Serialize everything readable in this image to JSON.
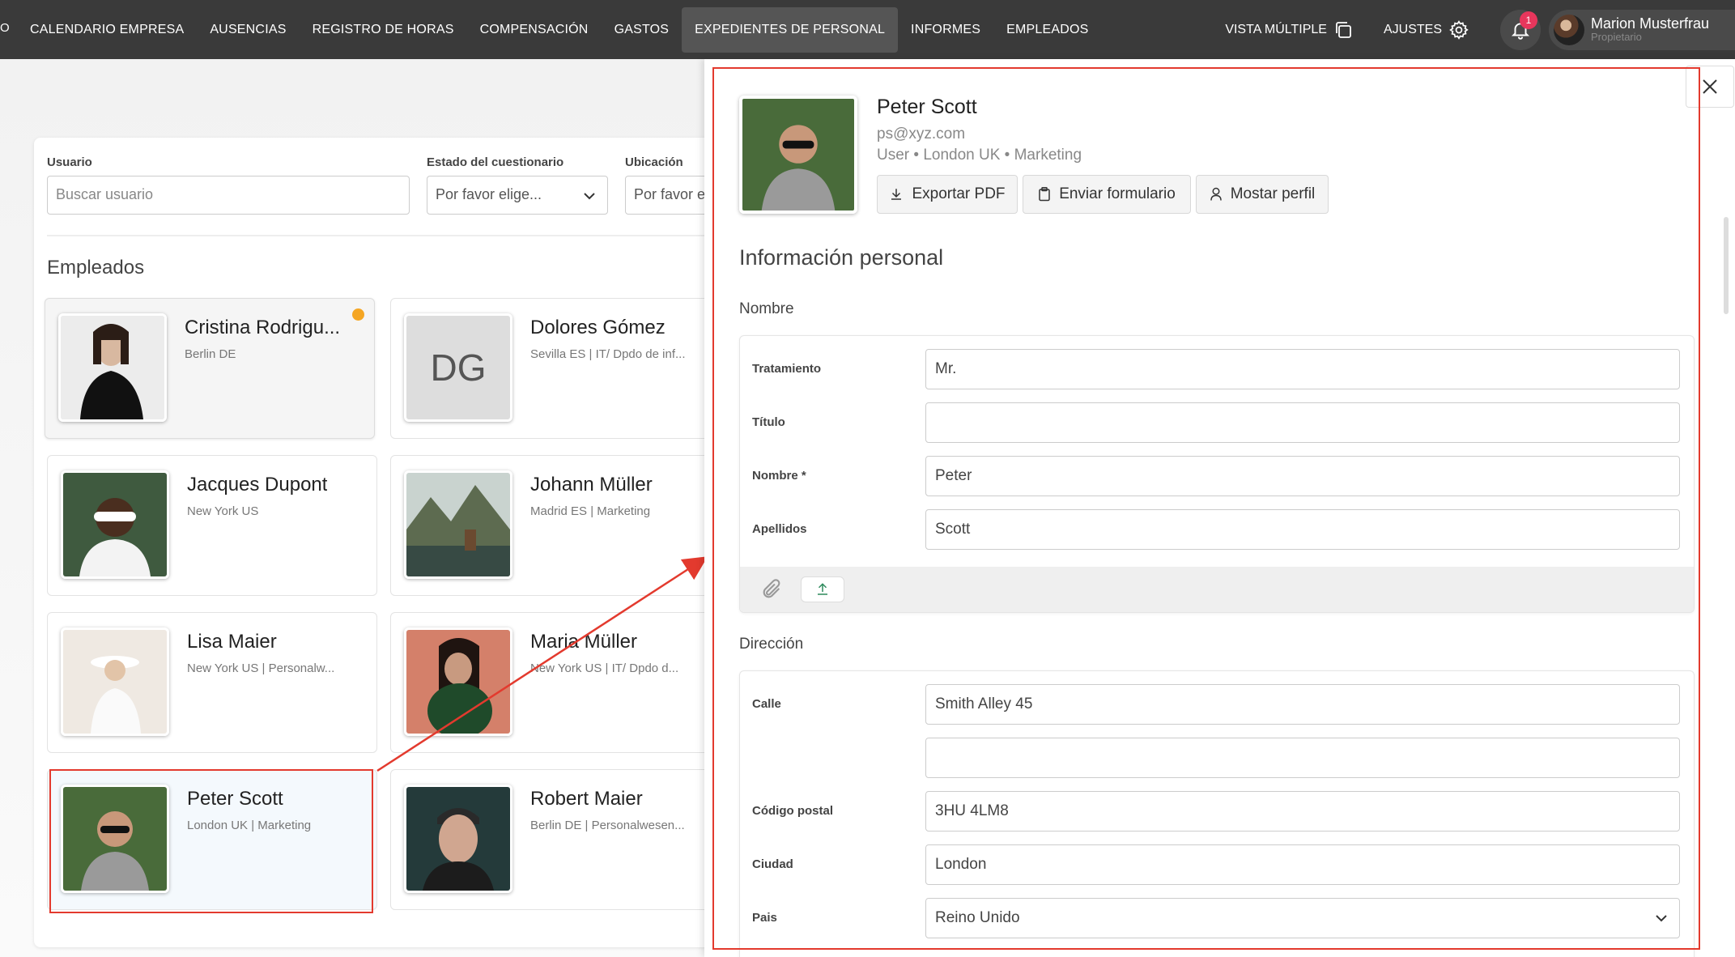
{
  "nav": {
    "edge": "O",
    "items": [
      "CALENDARIO EMPRESA",
      "AUSENCIAS",
      "REGISTRO DE HORAS",
      "COMPENSACIÓN",
      "GASTOS",
      "EXPEDIENTES DE PERSONAL",
      "INFORMES",
      "EMPLEADOS"
    ],
    "active": "EXPEDIENTES DE PERSONAL",
    "vista": "VISTA MÚLTIPLE",
    "ajustes": "AJUSTES",
    "notif_count": "1",
    "user_name": "Marion Musterfrau",
    "user_role": "Propietario"
  },
  "filters": {
    "usuario_label": "Usuario",
    "usuario_placeholder": "Buscar usuario",
    "estado_label": "Estado del cuestionario",
    "estado_value": "Por favor elige...",
    "ubicacion_label": "Ubicación",
    "ubicacion_value": "Por favor e"
  },
  "section_title": "Empleados",
  "employees": [
    {
      "name": "Cristina Rodrigu...",
      "sub": "Berlin DE"
    },
    {
      "name": "Dolores Gómez",
      "sub": "Sevilla ES | IT/ Dpdo de inf...",
      "initials": "DG"
    },
    {
      "name": "Jacques Dupont",
      "sub": "New York US"
    },
    {
      "name": "Johann Müller",
      "sub": "Madrid ES | Marketing"
    },
    {
      "name": "Lisa Maier",
      "sub": "New York US | Personalw..."
    },
    {
      "name": "Maria Müller",
      "sub": "New York US | IT/ Dpdo d..."
    },
    {
      "name": "Peter Scott",
      "sub": "London UK | Marketing"
    },
    {
      "name": "Robert Maier",
      "sub": "Berlin DE | Personalwesen..."
    }
  ],
  "panel": {
    "name": "Peter Scott",
    "email": "ps@xyz.com",
    "meta": "User • London UK • Marketing",
    "btn_pdf": "Exportar PDF",
    "btn_form": "Enviar formulario",
    "btn_profile": "Mostar perfil",
    "title": "Información personal",
    "nombre_section": "Nombre",
    "fields": {
      "tratamiento_label": "Tratamiento",
      "tratamiento": "Mr.",
      "titulo_label": "Título",
      "titulo": "",
      "nombre_label": "Nombre *",
      "nombre": "Peter",
      "apellidos_label": "Apellidos",
      "apellidos": "Scott"
    },
    "direccion_section": "Dirección",
    "address": {
      "calle_label": "Calle",
      "calle": "Smith Alley 45",
      "calle2": "",
      "cp_label": "Código postal",
      "cp": "3HU 4LM8",
      "ciudad_label": "Ciudad",
      "ciudad": "London",
      "pais_label": "Pais",
      "pais": "Reino Unido"
    }
  }
}
